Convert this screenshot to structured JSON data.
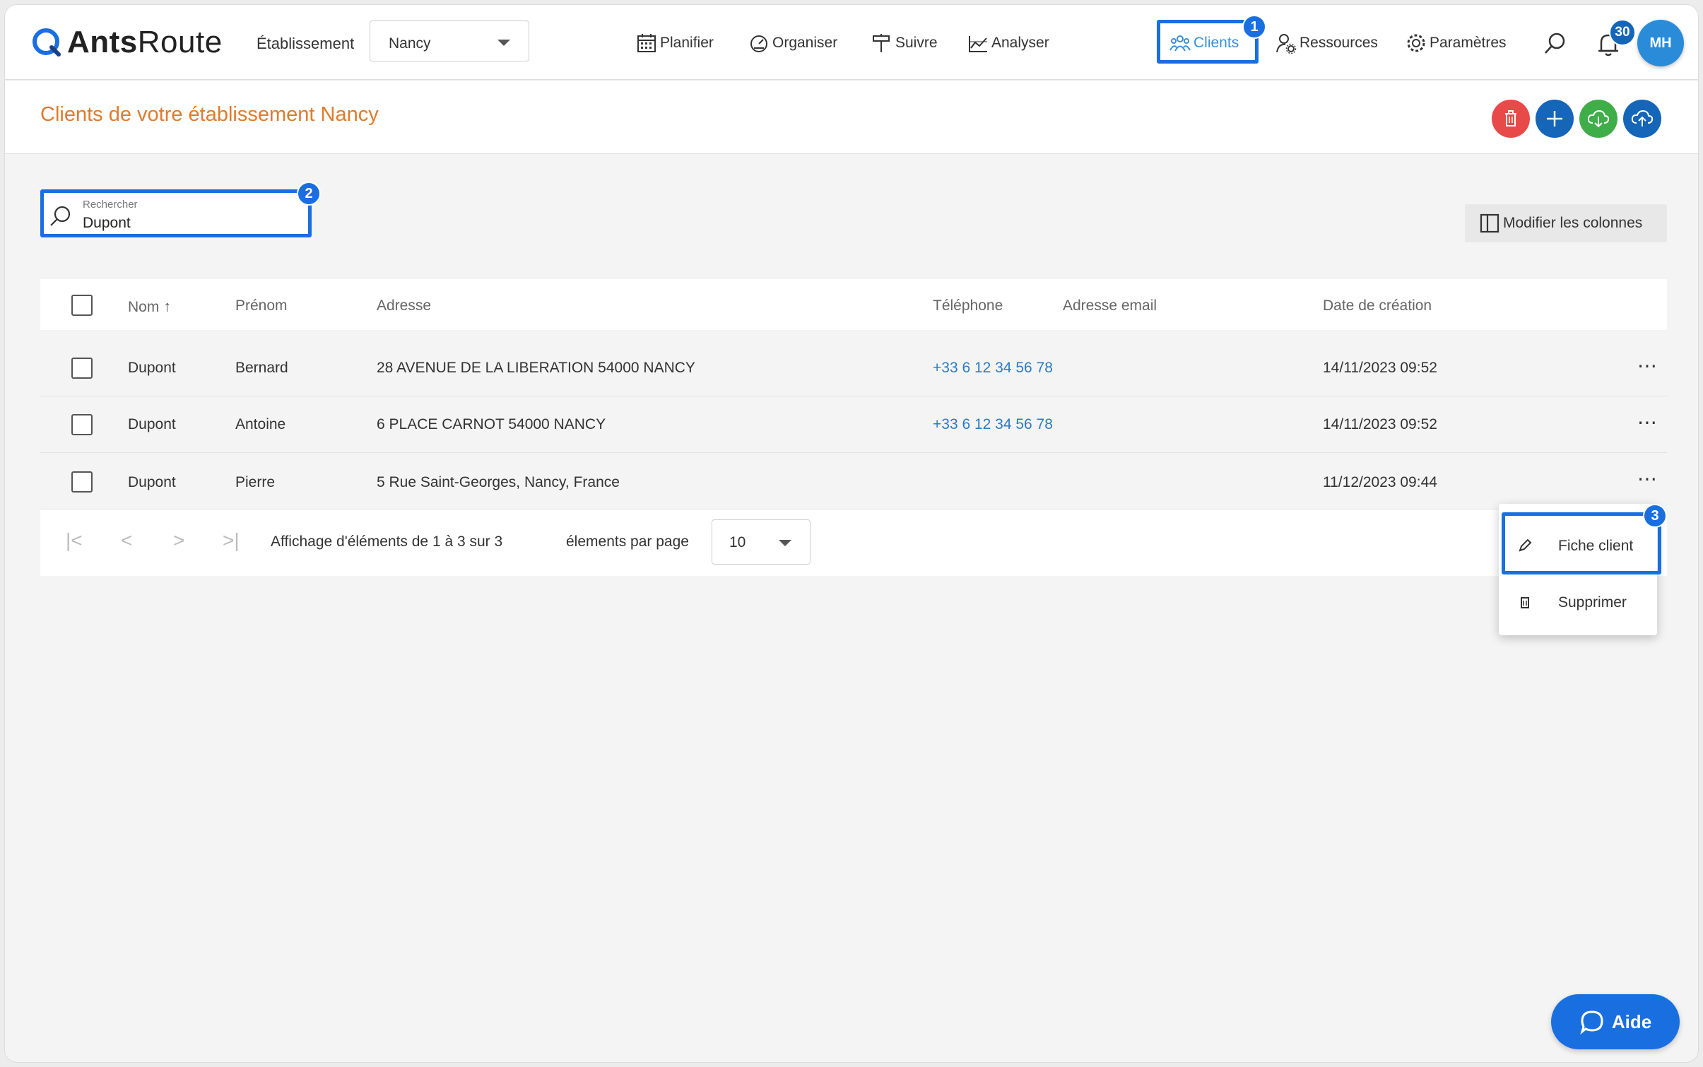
{
  "app": {
    "logo_bold": "Ants",
    "logo_regular": "Route"
  },
  "topbar": {
    "etablissement_label": "Établissement",
    "etablissement_value": "Nancy",
    "nav": {
      "planifier": "Planifier",
      "organiser": "Organiser",
      "suivre": "Suivre",
      "analyser": "Analyser",
      "clients": "Clients",
      "ressources": "Ressources",
      "parametres": "Paramètres"
    },
    "notifications_count": "30",
    "avatar_initials": "MH"
  },
  "markers": {
    "one": "1",
    "two": "2",
    "three": "3"
  },
  "page": {
    "title": "Clients de votre établissement Nancy"
  },
  "search": {
    "label": "Rechercher",
    "value": "Dupont"
  },
  "columns_button": "Modifier les colonnes",
  "table": {
    "headers": {
      "nom": "Nom",
      "prenom": "Prénom",
      "adresse": "Adresse",
      "telephone": "Téléphone",
      "email": "Adresse email",
      "date": "Date de création"
    },
    "rows": [
      {
        "nom": "Dupont",
        "prenom": "Bernard",
        "adresse": "28 AVENUE DE LA LIBERATION 54000 NANCY",
        "telephone": "+33 6 12 34 56 78",
        "email": "",
        "date": "14/11/2023 09:52"
      },
      {
        "nom": "Dupont",
        "prenom": "Antoine",
        "adresse": "6 PLACE CARNOT 54000 NANCY",
        "telephone": "+33 6 12 34 56 78",
        "email": "",
        "date": "14/11/2023 09:52"
      },
      {
        "nom": "Dupont",
        "prenom": "Pierre",
        "adresse": "5 Rue Saint-Georges, Nancy, France",
        "telephone": "",
        "email": "",
        "date": "11/12/2023 09:44"
      }
    ]
  },
  "pager": {
    "summary": "Affichage d'éléments de 1 à 3 sur 3",
    "per_page_label": "élements par page",
    "per_page_value": "10"
  },
  "context_menu": {
    "fiche_client": "Fiche client",
    "supprimer": "Supprimer"
  },
  "help_button": "Aide",
  "colors": {
    "accent": "#1a6fe0",
    "title": "#e07b2a",
    "delete": "#e84a4a",
    "add": "#1565b8",
    "export": "#3fae49",
    "import": "#1565b8"
  }
}
